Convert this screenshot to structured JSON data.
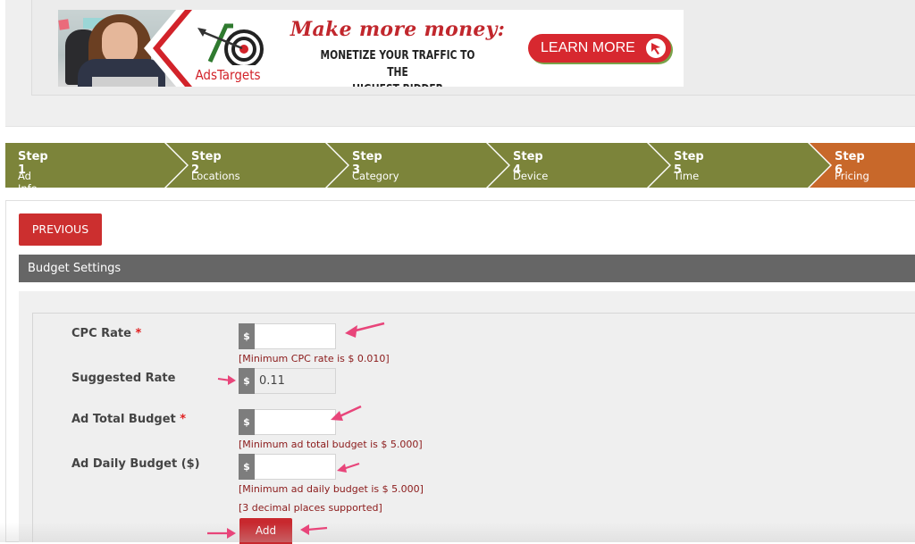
{
  "banner": {
    "brand_name": "AdsTargets",
    "headline": "Make more money:",
    "subline_line1": "MONETIZE YOUR TRAFFIC TO THE",
    "subline_line2": "HIGHEST BIDDER",
    "cta_label": "LEARN MORE",
    "colors": {
      "brand_red": "#d2232a",
      "cta_bg": "#d7282f",
      "accent_green": "#79a34a"
    }
  },
  "wizard": {
    "colors": {
      "inactive": "#7c843a",
      "active": "#c8682a"
    },
    "active_step": 6,
    "steps": [
      {
        "title": "Step 1",
        "subtitle": "Ad Info"
      },
      {
        "title": "Step 2",
        "subtitle": "Locations"
      },
      {
        "title": "Step 3",
        "subtitle": "Category"
      },
      {
        "title": "Step 4",
        "subtitle": "Device"
      },
      {
        "title": "Step 5",
        "subtitle": "Time"
      },
      {
        "title": "Step 6",
        "subtitle": "Pricing"
      }
    ]
  },
  "actions": {
    "previous_label": "PREVIOUS",
    "add_label": "Add"
  },
  "section": {
    "title": "Budget Settings"
  },
  "form": {
    "currency_symbol": "$",
    "required_marker": "*",
    "cpc_rate": {
      "label": "CPC Rate",
      "value": "",
      "hint": "[Minimum CPC rate is $ 0.010]"
    },
    "suggested_rate": {
      "label": "Suggested Rate",
      "value": "0.11"
    },
    "total_budget": {
      "label": "Ad Total Budget",
      "value": "",
      "hint": "[Minimum ad total budget is $ 5.000]"
    },
    "daily_budget": {
      "label": "Ad Daily Budget ($)",
      "value": "",
      "hint": "[Minimum ad daily budget is $ 5.000]"
    },
    "decimal_note": "[3 decimal places supported]"
  },
  "annotation_color": "#e8457a"
}
